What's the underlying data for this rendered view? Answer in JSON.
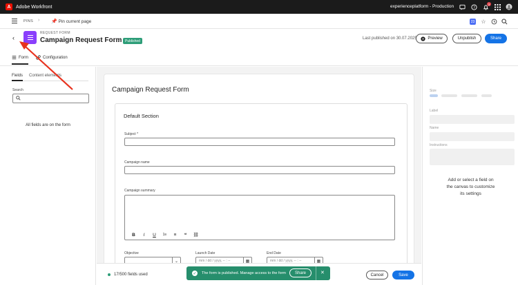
{
  "topbar": {
    "logo": "A",
    "app_name": "Adobe Workfront",
    "org_name": "experienceplatform - Production",
    "notification_count": "3"
  },
  "pinsbar": {
    "pins_label": "PINS",
    "pin_current_label": "Pin current page",
    "calendar_day": "23"
  },
  "header": {
    "kicker": "REQUEST FORM",
    "title": "Campaign Request Form",
    "more": "…",
    "status_badge": "Published",
    "last_published": "Last published on 30.07.2025",
    "preview_label": "Preview",
    "unpublish_label": "Unpublish",
    "share_label": "Share"
  },
  "tabs": {
    "form_label": "Form",
    "config_label": "Configuration"
  },
  "left_panel": {
    "tab_fields": "Fields",
    "tab_content": "Content elements",
    "search_label": "Search",
    "search_value": "",
    "empty_message": "All fields are on the form"
  },
  "canvas": {
    "form_title": "Campaign Request Form",
    "section_title": "Default Section",
    "fields": {
      "subject_label": "Subject *",
      "campaign_name_label": "Campaign name",
      "campaign_summary_label": "Campaign summary",
      "objective_label": "Objective",
      "launch_date_label": "Launch Date",
      "launch_date_placeholder": "mm / dd / yyyy, -- : --",
      "end_date_label": "End Date",
      "end_date_placeholder": "mm / dd / yyyy, -- : --"
    },
    "rte_tools": [
      "B",
      "I",
      "U",
      "1≡",
      "≡",
      "❝",
      "⛓"
    ]
  },
  "right_panel": {
    "size_label": "Size",
    "label_label": "Label",
    "name_label": "Name",
    "instructions_label": "Instructions",
    "message_line1": "Add or select a field on",
    "message_line2": "the canvas to customize",
    "message_line3": "its settings"
  },
  "footer": {
    "fields_count": "17/500 fields used",
    "cancel_label": "Cancel",
    "save_label": "Save"
  },
  "toast": {
    "message": "The form is published. Manage access to the form",
    "share_label": "Share",
    "close": "✕"
  },
  "colors": {
    "accent": "#1473e6",
    "form_icon": "#8a3ffc",
    "published": "#2d9d78",
    "toast": "#268e6c",
    "annotation": "#e8321e"
  }
}
